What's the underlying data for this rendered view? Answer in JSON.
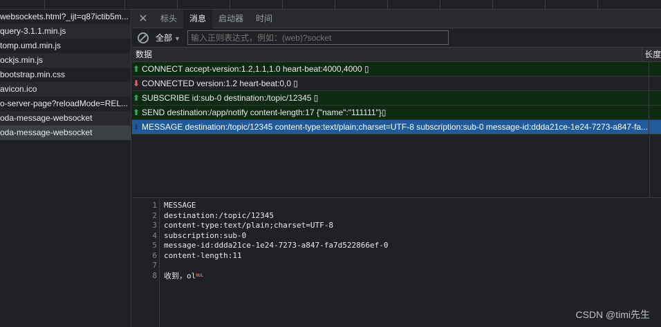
{
  "requests": [
    {
      "name": "websockets.html?_ijt=q87ictib5m..."
    },
    {
      "name": "query-3.1.1.min.js"
    },
    {
      "name": "tomp.umd.min.js"
    },
    {
      "name": "ockjs.min.js"
    },
    {
      "name": "bootstrap.min.css"
    },
    {
      "name": "avicon.ico"
    },
    {
      "name": "o-server-page?reloadMode=REL..."
    },
    {
      "name": "oda-message-websocket"
    },
    {
      "name": "oda-message-websocket"
    }
  ],
  "tabs": {
    "close": "✕",
    "headers": "标头",
    "messages": "消息",
    "initiator": "启动器",
    "timing": "时间"
  },
  "filter": {
    "select_value": "全部",
    "placeholder": "输入正则表达式，例如：(web)?socket"
  },
  "grid": {
    "col_data": "数据",
    "col_length": "长度"
  },
  "frames": [
    {
      "dir": "up",
      "text": "CONNECT accept-version:1.2,1.1,1.0 heart-beat:4000,4000 ▯"
    },
    {
      "dir": "down",
      "text": "CONNECTED version:1.2 heart-beat:0,0 ▯"
    },
    {
      "dir": "up",
      "text": "SUBSCRIBE id:sub-0 destination:/topic/12345 ▯"
    },
    {
      "dir": "up",
      "text": "SEND destination:/app/notify content-length:17 {\"name\":\"111111\"}▯"
    },
    {
      "dir": "down",
      "text": "MESSAGE destination:/topic/12345 content-type:text/plain;charset=UTF-8 subscription:sub-0 message-id:ddda21ce-1e24-7273-a847-fa..."
    }
  ],
  "preview": {
    "lines": [
      {
        "n": "1",
        "text": "MESSAGE"
      },
      {
        "n": "2",
        "text": "destination:/topic/12345"
      },
      {
        "n": "3",
        "text": "content-type:text/plain;charset=UTF-8"
      },
      {
        "n": "4",
        "text": "subscription:sub-0"
      },
      {
        "n": "5",
        "text": "message-id:ddda21ce-1e24-7273-a847-fa7d522866ef-0"
      },
      {
        "n": "6",
        "text": "content-length:11"
      },
      {
        "n": "7",
        "text": ""
      },
      {
        "n": "8",
        "text": "收到，ol"
      }
    ],
    "nul_marker": "NUL"
  },
  "watermark": "CSDN @timi先生",
  "colors": {
    "sent_bg": "#0f2a12",
    "selected_bg": "#1f5b9c",
    "up_arrow": "#37a85a",
    "down_arrow": "#e06262"
  }
}
